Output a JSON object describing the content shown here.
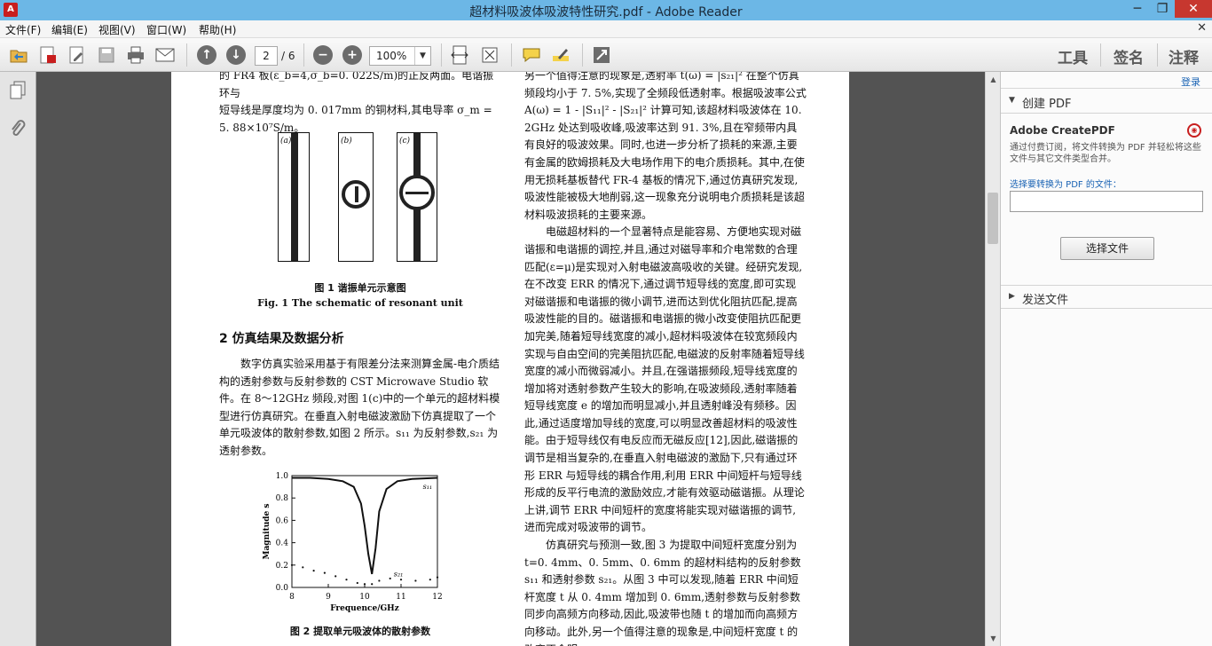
{
  "window": {
    "title": "超材料吸波体吸波特性研究.pdf - Adobe Reader",
    "app_icon": "A",
    "minimize_glyph": "─",
    "restore_glyph": "❐",
    "close_glyph": "✕"
  },
  "menu": {
    "items": [
      "文件(F)",
      "编辑(E)",
      "视图(V)",
      "窗口(W)",
      "帮助(H)"
    ],
    "close_glyph": "✕"
  },
  "toolbar": {
    "page_current": "2",
    "page_total": "/ 6",
    "zoom": "100%",
    "right_tabs": [
      "工具",
      "签名",
      "注释"
    ]
  },
  "document": {
    "left_top_lines": [
      "的 FR4 板(ε_b=4,σ_b=0. 022S/m)的正反两面。电谐振环与",
      "短导线是厚度均为 0. 017mm 的铜材料,其电导率 σ_m =",
      "5. 88×10⁷S/m。"
    ],
    "fig1_panel_labels": [
      "(a)",
      "(b)",
      "(c)"
    ],
    "fig1_caption_cn": "图 1   谐振单元示意图",
    "fig1_caption_en": "Fig. 1   The schematic of resonant unit",
    "section_heading": "2   仿真结果及数据分析",
    "section_paragraph": "数字仿真实验采用基于有限差分法来测算金属-电介质结构的透射参数与反射参数的 CST Microwave Studio 软件。在 8～12GHz 频段,对图 1(c)中的一个单元的超材料模型进行仿真研究。在垂直入射电磁波激励下仿真提取了一个单元吸波体的散射参数,如图 2 所示。s₁₁ 为反射参数,s₂₁ 为透射参数。",
    "fig2_caption_cn": "图 2   提取单元吸波体的散射参数",
    "right_paragraph_1": "另一个值得注意的现象是,透射率 t(ω) = |s₂₁|² 在整个仿真频段均小于 7. 5%,实现了全频段低透射率。根据吸波率公式 A(ω) = 1 - |S₁₁|² - |S₂₁|² 计算可知,该超材料吸波体在 10. 2GHz 处达到吸收峰,吸波率达到 91. 3%,且在窄频带内具有良好的吸波效果。同时,也进一步分析了损耗的来源,主要有金属的欧姆损耗及大电场作用下的电介质损耗。其中,在使用无损耗基板替代 FR-4 基板的情况下,通过仿真研究发现,吸波性能被极大地削弱,这一现象充分说明电介质损耗是该超材料吸波损耗的主要来源。",
    "right_paragraph_2": "电磁超材料的一个显著特点是能容易、方便地实现对磁谐振和电谐振的调控,并且,通过对磁导率和介电常数的合理匹配(ε=μ)是实现对入射电磁波高吸收的关键。经研究发现,在不改变 ERR 的情况下,通过调节短导线的宽度,即可实现对磁谐振和电谐振的微小调节,进而达到优化阻抗匹配,提高吸波性能的目的。磁谐振和电谐振的微小改变使阻抗匹配更加完美,随着短导线宽度的减小,超材料吸波体在较宽频段内实现与自由空间的完美阻抗匹配,电磁波的反射率随着短导线宽度的减小而微弱减小。并且,在强谐振频段,短导线宽度的增加将对透射参数产生较大的影响,在吸波频段,透射率随着短导线宽度 e 的增加而明显减小,并且透射峰没有频移。因此,通过适度增加导线的宽度,可以明显改善超材料的吸波性能。由于短导线仅有电反应而无磁反应[12],因此,磁谐振的调节是相当复杂的,在垂直入射电磁波的激励下,只有通过环形 ERR 与短导线的耦合作用,利用 ERR 中间短杆与短导线形成的反平行电流的激励效应,才能有效驱动磁谐振。从理论上讲,调节 ERR 中间短杆的宽度将能实现对磁谐振的调节,进而完成对吸波带的调节。",
    "right_paragraph_3": "仿真研究与预测一致,图 3 为提取中间短杆宽度分别为 t=0. 4mm、0. 5mm、0. 6mm 的超材料结构的反射参数 s₁₁ 和透射参数 s₂₁。从图 3 中可以发现,随着 ERR 中间短杆宽度 t 从 0. 4mm 增加到 0. 6mm,透射参数与反射参数同步向高频方向移动,因此,吸波带也随 t 的增加而向高频方向移动。此外,另一个值得注意的现象是,中间短杆宽度 t 的改变不会明"
  },
  "chart_data": {
    "type": "line",
    "xlabel": "Frequence/GHz",
    "ylabel": "Magnitude s",
    "xlim": [
      8,
      12
    ],
    "ylim": [
      0.0,
      1.0
    ],
    "xticks": [
      "8",
      "9",
      "10",
      "11",
      "12"
    ],
    "yticks": [
      "0.0",
      "0.2",
      "0.4",
      "0.6",
      "0.8",
      "1.0"
    ],
    "series": [
      {
        "name": "s₁₁",
        "style": "solid",
        "x": [
          8.0,
          8.5,
          9.0,
          9.4,
          9.7,
          9.9,
          10.0,
          10.1,
          10.2,
          10.3,
          10.4,
          10.6,
          10.9,
          11.3,
          12.0
        ],
        "y": [
          0.98,
          0.98,
          0.97,
          0.95,
          0.9,
          0.75,
          0.55,
          0.3,
          0.12,
          0.35,
          0.68,
          0.88,
          0.95,
          0.97,
          0.98
        ]
      },
      {
        "name": "s₂₁",
        "style": "dotted",
        "x": [
          8.0,
          8.3,
          8.6,
          8.9,
          9.2,
          9.5,
          9.8,
          10.0,
          10.2,
          10.4,
          10.7,
          11.0,
          11.4,
          11.8,
          12.0
        ],
        "y": [
          0.2,
          0.18,
          0.15,
          0.13,
          0.1,
          0.07,
          0.04,
          0.03,
          0.03,
          0.06,
          0.08,
          0.07,
          0.06,
          0.07,
          0.09
        ]
      }
    ]
  },
  "rightpane": {
    "login": "登录",
    "create_pdf_label": "创建 PDF",
    "create_heading": "Adobe CreatePDF",
    "create_desc": "通过付费订阅，将文件转换为 PDF 并轻松将这些文件与其它文件类型合并。",
    "select_link": "选择要转换为 PDF 的文件：",
    "select_button": "选择文件",
    "send_label": "发送文件"
  }
}
